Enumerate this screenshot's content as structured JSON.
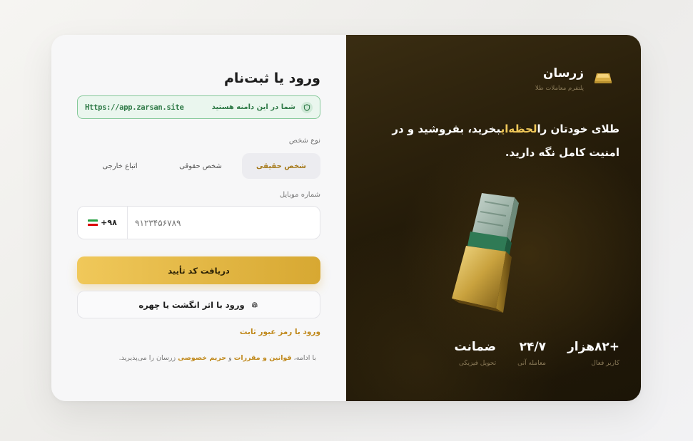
{
  "form": {
    "title": "ورود یا ثبت‌نام",
    "domain_notice": "شما در این دامنه هستید",
    "domain_url": "Https://app.zarsan.site",
    "person_type_label": "نوع شخص",
    "person_types": [
      "شخص حقیقی",
      "شخص حقوقی",
      "اتباع خارجی"
    ],
    "mobile_label": "شماره موبایل",
    "country_code": "+۹۸",
    "phone_placeholder": "۹۱۲۳۴۵۶۷۸۹",
    "get_code_button": "دریافت کد تأیید",
    "biometric_button": "ورود با اثر انگشت یا چهره",
    "password_link": "ورود با رمز عبور ثابت",
    "terms_prefix": "با ادامه،",
    "terms_link": "قوانین و مقررات",
    "terms_and": "و",
    "privacy_link": "حریم خصوصی",
    "terms_suffix": "زرسان را می‌پذیرید."
  },
  "brand": {
    "name": "زرسان",
    "tagline": "پلتفرم معاملات طلا",
    "headline_part1": "طلای خودتان را",
    "headline_highlight": "لحظه‌ای",
    "headline_part2": "بخرید، بفروشید و در امنیت کامل نگه دارید.",
    "stats": [
      {
        "value": "+۸۲هزار",
        "label": "کاربر فعال"
      },
      {
        "value": "۲۴/۷",
        "label": "معامله آنی"
      },
      {
        "value": "ضمانت",
        "label": "تحویل فیزیکی"
      }
    ],
    "accent_color": "#f0c85a"
  }
}
